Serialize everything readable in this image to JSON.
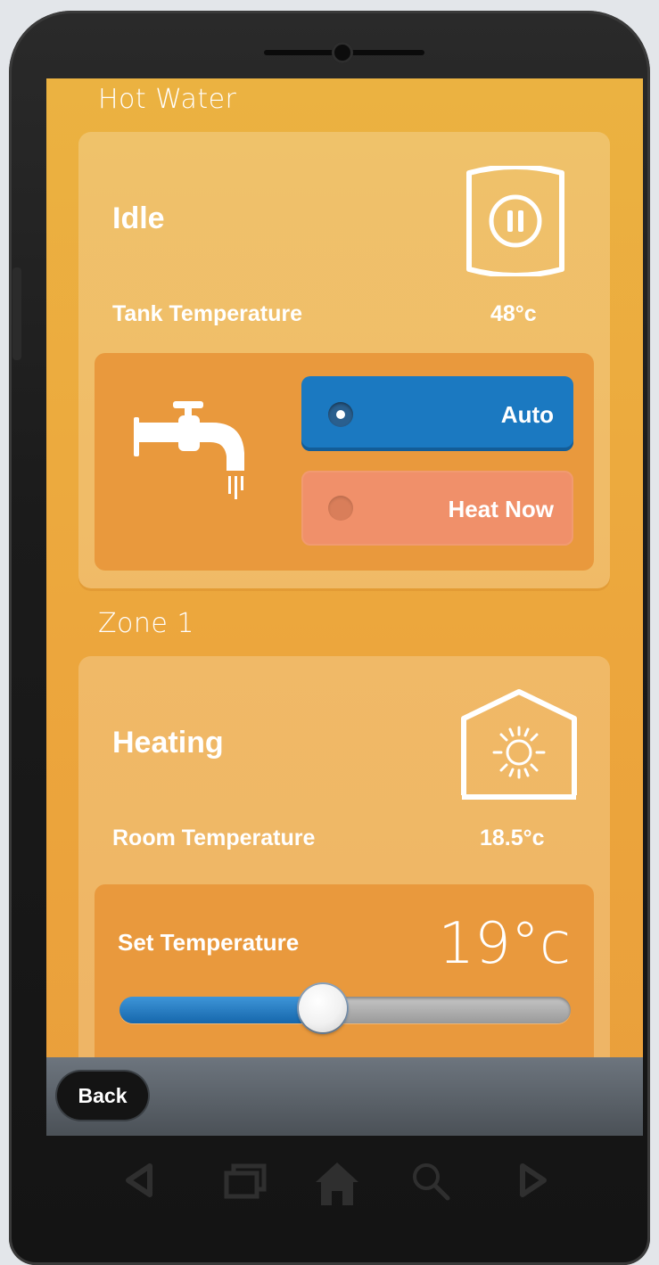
{
  "hot_water": {
    "section_title": "Hot Water",
    "status": "Idle",
    "temp_label": "Tank Temperature",
    "temp_value": "48°c",
    "modes": [
      {
        "label": "Auto",
        "selected": true
      },
      {
        "label": "Heat Now",
        "selected": false
      }
    ],
    "icons": {
      "status": "tank-pause-icon",
      "tap": "tap-icon"
    }
  },
  "zone1": {
    "section_title": "Zone 1",
    "status": "Heating",
    "temp_label": "Room Temperature",
    "temp_value": "18.5°c",
    "set_label": "Set Temperature",
    "set_value": "19°c",
    "slider_level": 0.45,
    "icons": {
      "status": "house-sun-icon"
    }
  },
  "bottom_bar": {
    "back_label": "Back"
  },
  "android_nav": [
    "back-triangle-icon",
    "recent-apps-icon",
    "home-icon",
    "search-icon",
    "forward-triangle-icon"
  ],
  "colors": {
    "accent_blue": "#1b79c1",
    "heat_now": "#f0906a",
    "background": "#eca73d"
  }
}
